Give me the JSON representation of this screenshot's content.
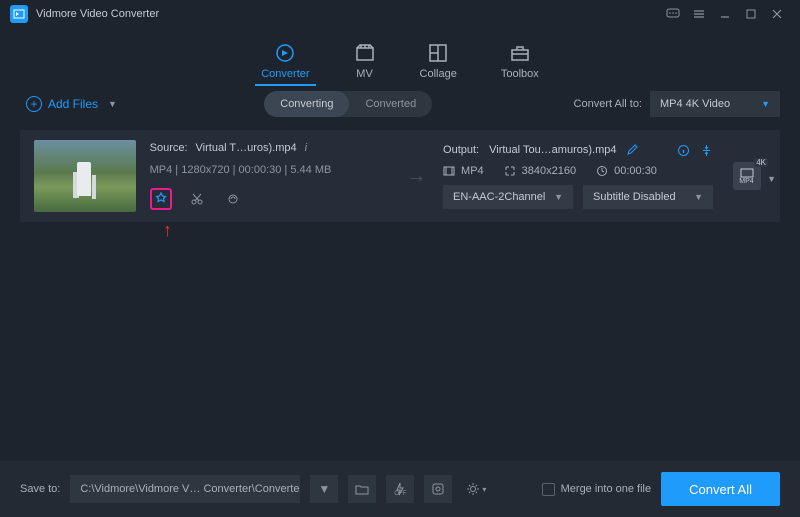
{
  "app": {
    "title": "Vidmore Video Converter"
  },
  "tabs": {
    "converter": "Converter",
    "mv": "MV",
    "collage": "Collage",
    "toolbox": "Toolbox"
  },
  "toolbar": {
    "add_files": "Add Files",
    "converting": "Converting",
    "converted": "Converted",
    "convert_all_to": "Convert All to:",
    "format_selected": "MP4 4K Video"
  },
  "file": {
    "source_label": "Source:",
    "source_name": "Virtual T…uros).mp4",
    "format": "MP4",
    "resolution": "1280x720",
    "duration": "00:00:30",
    "size": "5.44 MB",
    "output_label": "Output:",
    "output_name": "Virtual Tou…amuros).mp4",
    "out_format": "MP4",
    "out_resolution": "3840x2160",
    "out_duration": "00:00:30",
    "audio": "EN-AAC-2Channel",
    "subtitle": "Subtitle Disabled",
    "badge": "4K",
    "badge_fmt": "MP4"
  },
  "footer": {
    "save_to": "Save to:",
    "path": "C:\\Vidmore\\Vidmore V… Converter\\Converted",
    "merge": "Merge into one file",
    "convert_all": "Convert All"
  }
}
